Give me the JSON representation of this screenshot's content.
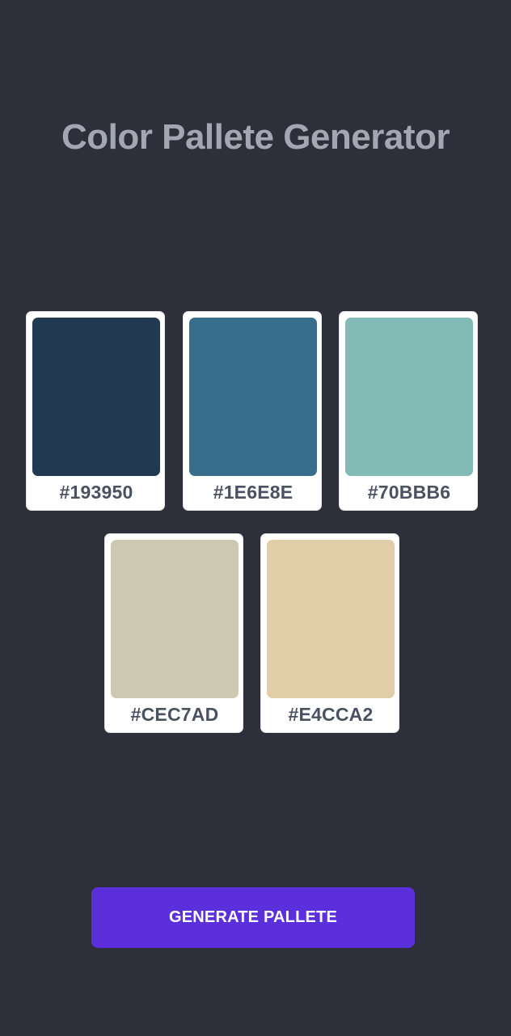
{
  "title": "Color Pallete Generator",
  "palette": [
    {
      "hex": "#193950",
      "swatch_color": "#213a52"
    },
    {
      "hex": "#1E6E8E",
      "swatch_color": "#386e8c"
    },
    {
      "hex": "#70BBB6",
      "swatch_color": "#82bab5"
    },
    {
      "hex": "#CEC7AD",
      "swatch_color": "#cdc8b2"
    },
    {
      "hex": "#E4CCA2",
      "swatch_color": "#e1cda8"
    }
  ],
  "generate_button_label": "GENERATE PALLETE",
  "colors": {
    "background": "#2d303a",
    "title": "#a3a7b3",
    "button": "#5b2fdc",
    "card": "#ffffff",
    "hex_text": "#4b5160"
  }
}
